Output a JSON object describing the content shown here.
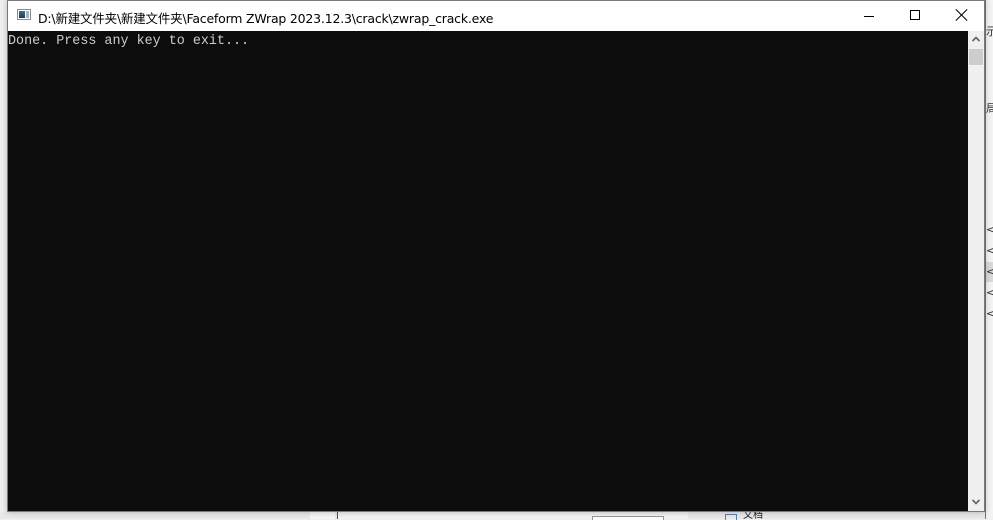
{
  "window": {
    "title": "D:\\新建文件夹\\新建文件夹\\Faceform ZWrap 2023.12.3\\crack\\zwrap_crack.exe",
    "controls": {
      "minimize": "minimize",
      "maximize": "maximize",
      "close": "close"
    }
  },
  "console": {
    "lines": [
      "Done. Press any key to exit..."
    ],
    "text_color": "#cccccc",
    "background_color": "#0c0c0c"
  },
  "background": {
    "right_glyphs": [
      "示",
      "局",
      "<.",
      "<.",
      "<.",
      "<.",
      "<."
    ],
    "bottom_text": "文档"
  }
}
